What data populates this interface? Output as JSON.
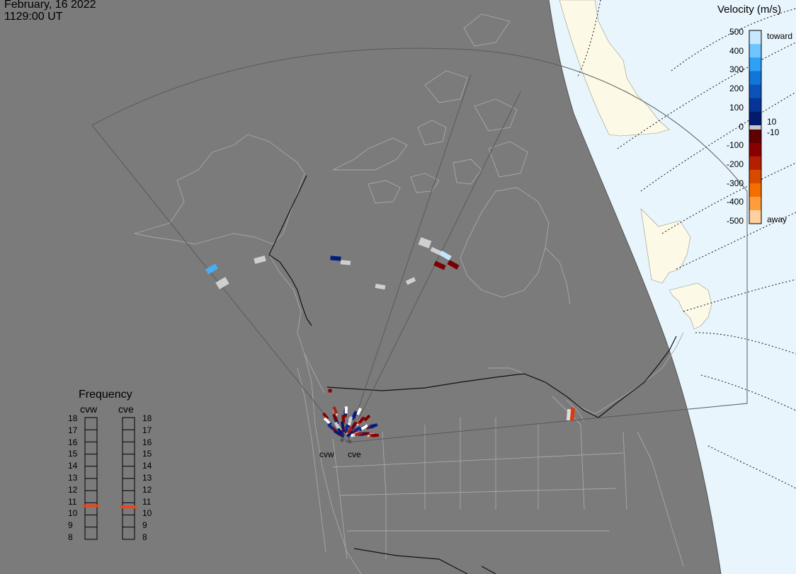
{
  "header": {
    "date": "February, 16 2022",
    "time": "1129:00 UT"
  },
  "colorbar": {
    "title": "Velocity (m/s)",
    "ticks": [
      "500",
      "400",
      "300",
      "200",
      "100",
      "0",
      "-100",
      "-200",
      "-300",
      "-400",
      "-500"
    ],
    "toward_label": "toward",
    "away_label": "away",
    "cut_pos_label": "10",
    "cut_neg_label": "-10",
    "colors_toward": [
      "#c6e9ff",
      "#6fc5ff",
      "#2ea0f5",
      "#1275d8",
      "#0a53b8",
      "#063498",
      "#021b6e"
    ],
    "colors_away": [
      "#5e0000",
      "#8a0000",
      "#b51f00",
      "#d84a00",
      "#f56e00",
      "#ff9d3a",
      "#ffd0a0"
    ]
  },
  "radars": [
    {
      "code": "cvw",
      "name": "cvw"
    },
    {
      "code": "cve",
      "name": "cve"
    }
  ],
  "frequency": {
    "title": "Frequency",
    "columns": [
      "cvw",
      "cve"
    ],
    "levels": [
      "18",
      "17",
      "16",
      "15",
      "14",
      "13",
      "12",
      "11",
      "10",
      "9",
      "8"
    ],
    "cvw_value": 10.7,
    "cve_value": 10.6,
    "marker_color": "#e8471a"
  },
  "map": {
    "land_color": "#7b7b7b",
    "daylight_ocean_color": "#e8f5fc",
    "daylight_land_color": "#fcf9e6",
    "outline_color": "#a8a8a8"
  }
}
